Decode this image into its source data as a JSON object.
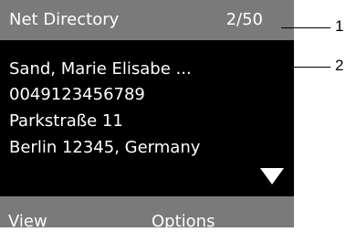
{
  "header": {
    "title": "Net Directory",
    "count": "2/50"
  },
  "entry": {
    "name": "Sand, Marie Elisabe ...",
    "phone": "0049123456789",
    "street": "Parkstraße 11",
    "city": "Berlin 12345, Germany"
  },
  "softkeys": {
    "left": "View",
    "right": "Options"
  },
  "callouts": {
    "header": "1",
    "entry": "2"
  },
  "icons": {
    "scroll": "down-triangle-icon"
  },
  "colors": {
    "bar": "#7a7a7a",
    "screen": "#000000",
    "text": "#ffffff"
  }
}
